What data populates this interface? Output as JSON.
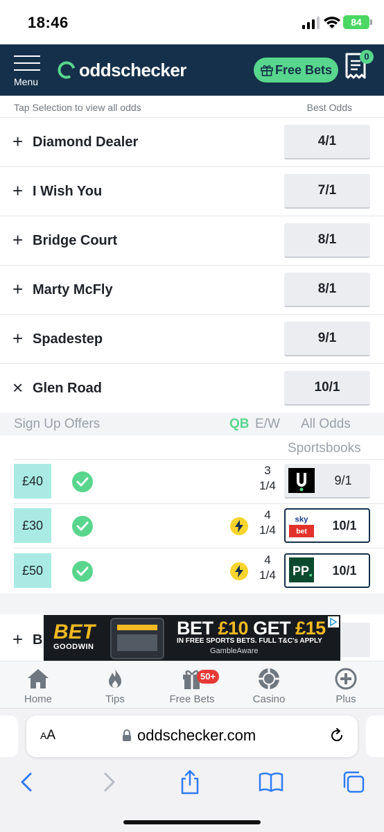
{
  "status_bar": {
    "time": "18:46",
    "battery": "84"
  },
  "header": {
    "menu_label": "Menu",
    "logo_text": "oddschecker",
    "free_bets_label": "Free Bets",
    "betslip_count": "0"
  },
  "list": {
    "hint": "Tap Selection to view all odds",
    "best_odds_label": "Best Odds",
    "runners": [
      {
        "toggle": "+",
        "name": "Diamond Dealer",
        "odds": "4/1"
      },
      {
        "toggle": "+",
        "name": "I Wish You",
        "odds": "7/1"
      },
      {
        "toggle": "+",
        "name": "Bridge Court",
        "odds": "8/1"
      },
      {
        "toggle": "+",
        "name": "Marty McFly",
        "odds": "8/1"
      },
      {
        "toggle": "+",
        "name": "Spadestep",
        "odds": "9/1"
      },
      {
        "toggle": "×",
        "name": "Glen Road",
        "odds": "10/1"
      }
    ]
  },
  "expanded": {
    "sign_up_offers": "Sign Up Offers",
    "qb": "QB",
    "ew": "E/W",
    "all_odds": "All Odds",
    "sportsbooks": "Sportsbooks",
    "offers": [
      {
        "amount": "£40",
        "ew_places": "3",
        "ew_fraction": "1/4",
        "bookmaker": "unibet",
        "odds": "9/1",
        "quick_bet": false,
        "best": false
      },
      {
        "amount": "£30",
        "ew_places": "4",
        "ew_fraction": "1/4",
        "bookmaker": "sky bet",
        "odds": "10/1",
        "quick_bet": true,
        "best": true
      },
      {
        "amount": "£50",
        "ew_places": "4",
        "ew_fraction": "1/4",
        "bookmaker": "paddy power",
        "odds": "10/1",
        "quick_bet": true,
        "best": true
      }
    ]
  },
  "partial_row": {
    "toggle": "+",
    "name_fragment": "B"
  },
  "ad": {
    "brand_top": "BET",
    "brand_bottom": "GOODWIN",
    "headline_a": "BET ",
    "headline_b": "£10",
    "headline_c": " GET ",
    "headline_d": "£15",
    "subline": "IN FREE SPORTS BETS. FULL T&C's APPLY",
    "gamble_aware": "GambleAware"
  },
  "bottom_nav": {
    "items": [
      {
        "label": "Home"
      },
      {
        "label": "Tips"
      },
      {
        "label": "Free Bets",
        "badge": "50+"
      },
      {
        "label": "Casino"
      },
      {
        "label": "Plus"
      }
    ]
  },
  "browser": {
    "aa_small": "A",
    "aa_large": "A",
    "url": "oddschecker.com"
  },
  "colors": {
    "navy": "#15304a",
    "green": "#58d68d",
    "mint": "#a9ebe4",
    "bolt_yellow": "#f8d52e"
  }
}
